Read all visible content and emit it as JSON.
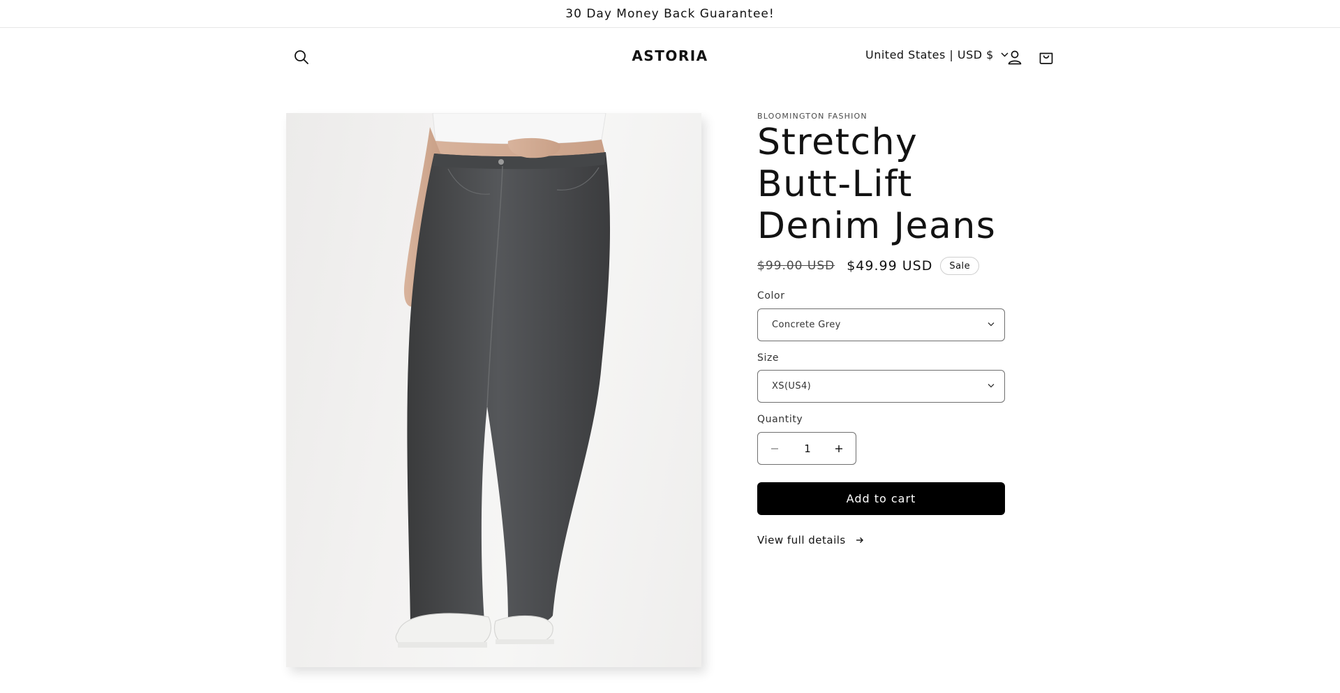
{
  "announcement": {
    "text": "30 Day Money Back Guarantee!"
  },
  "header": {
    "logo": "ASTORIA",
    "locale": "United States | USD $",
    "icons": {
      "search": "search-icon",
      "account": "account-icon",
      "cart": "cart-icon",
      "locale_caret": "chevron-down-icon"
    }
  },
  "product": {
    "vendor": "BLOOMINGTON FASHION",
    "title": "Stretchy Butt-Lift Denim Jeans",
    "price_regular": "$99.00 USD",
    "price_sale": "$49.99 USD",
    "badge": "Sale",
    "image_subject": "woman wearing high-waisted wide-leg grey denim jeans with white sneakers",
    "color": {
      "label": "Color",
      "value": "Concrete Grey"
    },
    "size": {
      "label": "Size",
      "value": "XS(US4)"
    },
    "quantity": {
      "label": "Quantity",
      "value": "1"
    },
    "add_to_cart": "Add to cart",
    "view_details": "View full details"
  },
  "colors": {
    "button_bg": "#000000",
    "text": "#121212",
    "border": "#6f6f6f"
  }
}
